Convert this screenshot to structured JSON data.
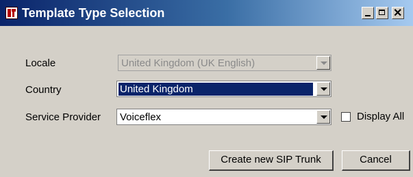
{
  "window": {
    "title": "Template Type Selection",
    "controls": {
      "minimize": "minimize-icon",
      "maximize": "maximize-icon",
      "close": "close-icon"
    }
  },
  "form": {
    "locale": {
      "label": "Locale",
      "value": "United Kingdom (UK English)",
      "disabled": true
    },
    "country": {
      "label": "Country",
      "value": "United Kingdom",
      "selected": true
    },
    "service_provider": {
      "label": "Service Provider",
      "value": "Voiceflex"
    },
    "display_all": {
      "label": "Display All",
      "checked": false
    }
  },
  "buttons": {
    "create": "Create new SIP Trunk",
    "cancel": "Cancel"
  },
  "colors": {
    "titlebar_start": "#0a246a",
    "titlebar_end": "#a6caf0",
    "dialog_bg": "#d4d0c8",
    "selection": "#0a246a"
  }
}
